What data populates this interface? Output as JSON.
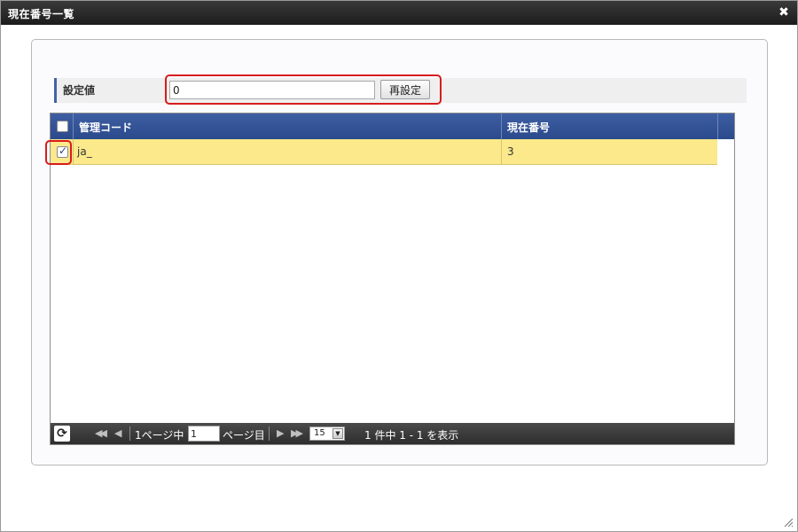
{
  "dialog": {
    "title": "現在番号一覧",
    "close_glyph": "✖"
  },
  "setting": {
    "label": "設定値",
    "input_value": "0",
    "reset_label": "再設定"
  },
  "grid": {
    "columns": [
      "管理コード",
      "現在番号"
    ],
    "rows": [
      {
        "selected": true,
        "code": "ja_",
        "current": "3"
      }
    ]
  },
  "pager": {
    "refresh_icon": "refresh-icon",
    "page_prefix": "1ページ中",
    "page_value": "1",
    "page_suffix": "ページ目",
    "rows_per_page": "15",
    "summary": "1 件中 1 - 1 を表示"
  },
  "colors": {
    "header_bg": "#2f4f92",
    "row_selected": "#fbe98c",
    "highlight": "#d81c1c",
    "titlebar": "#262626"
  }
}
